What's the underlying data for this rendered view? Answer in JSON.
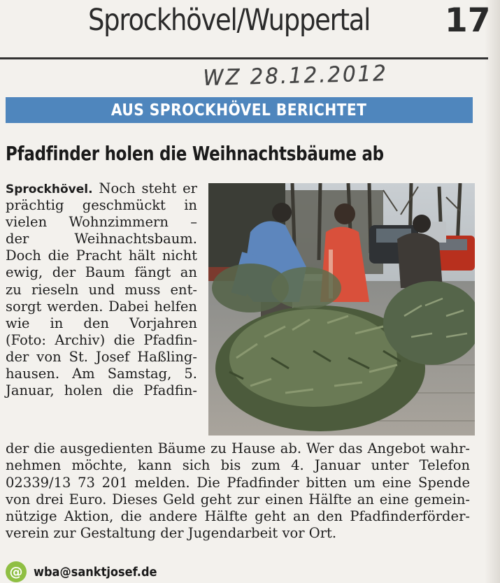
{
  "header": {
    "title": "Sprockhövel/Wuppertal",
    "page_number": "17"
  },
  "handwritten_date": "WZ 28.12.2012",
  "section_banner": "AUS SPROCKHÖVEL BERICHTET",
  "article": {
    "headline": "Pfadfinder holen die Weihnachtsbäume ab",
    "dateline": "Sprockhövel.",
    "column_lines": [
      " Noch steht er",
      "prächtig geschmückt in",
      "vielen Wohnzimmern –",
      "der Weihnachtsbaum.",
      "Doch die Pracht hält nicht",
      "ewig, der Baum fängt an",
      "zu rieseln und muss ent-",
      "sorgt werden. Dabei helfen",
      "wie in den Vorjahren",
      "(Foto: Archiv) die Pfadfin-",
      "der von St. Josef Haßling-",
      "hausen. Am Samstag, 5.",
      "Januar, holen die Pfadfin-"
    ],
    "full_lines": [
      "der die ausgedienten Bäume zu Hause ab. Wer das Angebot wahr-",
      "nehmen möchte, kann sich bis zum 4. Januar unter Telefon",
      "02339/13 73 201 melden. Die Pfadfinder bitten um eine Spende",
      "von drei Euro. Dieses Geld geht zur einen Hälfte an eine gemein-",
      "nützige Aktion, die andere Hälfte geht an den Pfadfinderförder-",
      "verein zur Gestaltung der Jugendarbeit vor Ort."
    ],
    "author_email": "wba@sanktjosef.de",
    "email_icon": "at-sign-icon"
  },
  "colors": {
    "banner": "#4f86bd",
    "email_icon": "#8fbf43"
  }
}
